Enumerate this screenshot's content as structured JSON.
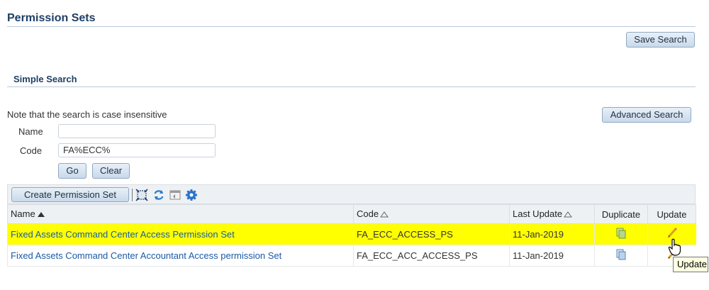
{
  "page": {
    "title": "Permission Sets"
  },
  "header": {
    "save_search_label": "Save Search"
  },
  "search": {
    "section_title": "Simple Search",
    "note": "Note that the search is case insensitive",
    "advanced_label": "Advanced Search",
    "name_label": "Name",
    "name_value": "",
    "code_label": "Code",
    "code_value": "FA%ECC%",
    "go_label": "Go",
    "clear_label": "Clear"
  },
  "toolbar": {
    "create_label": "Create Permission Set",
    "icons": [
      "detach-icon",
      "refresh-icon",
      "freeze-icon",
      "settings-icon"
    ]
  },
  "table": {
    "columns": [
      "Name",
      "Code",
      "Last Update",
      "Duplicate",
      "Update"
    ],
    "rows": [
      {
        "name": "Fixed Assets Command Center Access Permission Set",
        "code": "FA_ECC_ACCESS_PS",
        "last_update": "11-Jan-2019",
        "selected": true
      },
      {
        "name": "Fixed Assets Command Center Accountant Access permission Set",
        "code": "FA_ECC_ACC_ACCESS_PS",
        "last_update": "11-Jan-2019",
        "selected": false
      }
    ]
  },
  "tooltip": {
    "text": "Update"
  },
  "colors": {
    "title": "#1f3f66",
    "link": "#1b5aa6",
    "highlight": "#ffff00"
  }
}
